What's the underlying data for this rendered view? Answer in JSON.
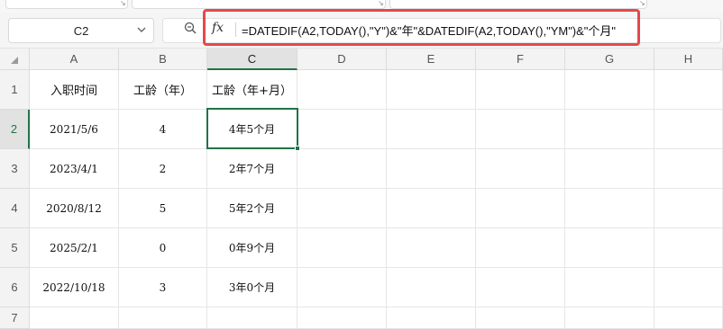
{
  "name_box": {
    "value": "C2"
  },
  "formula_bar": {
    "fx_label": "fx",
    "formula": "=DATEDIF(A2,TODAY(),\"Y\")&\"年\"&DATEDIF(A2,TODAY(),\"YM\")&\"个月\""
  },
  "highlight_color": "#e5484d",
  "selection_color": "#217346",
  "columns": [
    "A",
    "B",
    "C",
    "D",
    "E",
    "F",
    "G",
    "H"
  ],
  "rows": [
    "1",
    "2",
    "3",
    "4",
    "5",
    "6",
    "7"
  ],
  "sheet": {
    "header": [
      "入职时间",
      "工龄（年）",
      "工龄（年+月）"
    ],
    "data": [
      [
        "2021/5/6",
        "4",
        "4年5个月"
      ],
      [
        "2023/4/1",
        "2",
        "2年7个月"
      ],
      [
        "2020/8/12",
        "5",
        "5年2个月"
      ],
      [
        "2025/2/1",
        "0",
        "0年9个月"
      ],
      [
        "2022/10/18",
        "3",
        "3年0个月"
      ]
    ]
  },
  "active_cell": "C2"
}
